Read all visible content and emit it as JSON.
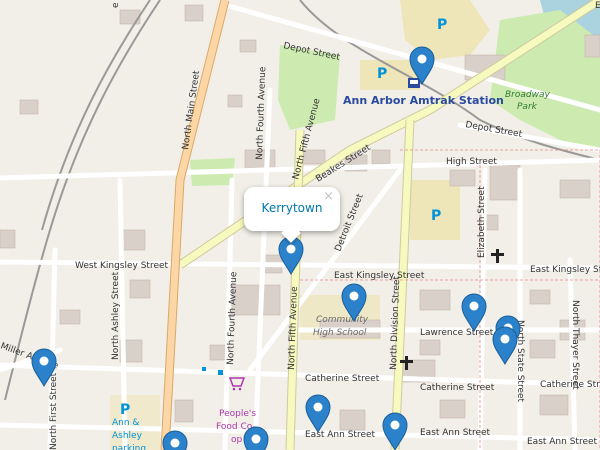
{
  "popup": {
    "title": "Kerrytown",
    "close_symbol": "×"
  },
  "labels": {
    "depot_street_1": "Depot Street",
    "depot_street_2": "Depot Street",
    "north_main": "North Main Street",
    "north_fourth": "North Fourth Avenue",
    "north_fourth_2": "North Fourth Avenue",
    "north_fifth_top": "North Fifth Avenue",
    "north_fifth": "North Fifth Avenue",
    "beakes": "Beakes Street",
    "high_street": "High Street",
    "detroit": "Detroit Street",
    "west_kingsley": "West Kingsley Street",
    "east_kingsley": "East Kingsley Street",
    "east_kingsley_2": "East Kingsley Street",
    "north_division": "North Division Street",
    "elizabeth": "Elizabeth Street",
    "north_state": "North State Street",
    "north_thayer": "North Thayer Street",
    "north_ashley": "North Ashley Street",
    "north_first": "North First Street",
    "miller": "Miller Avenue",
    "lawrence": "Lawrence Street",
    "catherine_1": "Catherine Street",
    "catherine_2": "Catherine Street",
    "catherine_3": "Catherine Street",
    "east_ann_1": "East Ann Street",
    "east_ann_2": "East Ann Street",
    "east_ann_3": "East Ann Street",
    "amtrak": "Ann Arbor Amtrak Station",
    "broadway_park_1": "Broadway",
    "broadway_park_2": "Park",
    "school_1": "Community",
    "school_2": "High School",
    "food_coop_1": "People's",
    "food_coop_2": "Food Co-",
    "food_coop_3": "op",
    "ann_ashley_1": "Ann &",
    "ann_ashley_2": "Ashley",
    "ann_ashley_3": "parking",
    "parking": "P",
    "edge_left": "e",
    "edge_right": "E"
  },
  "colors": {
    "land": "#f2efe9",
    "building": "#d9d0c9",
    "park": "#cdebb0",
    "parking_area": "#eee5b8",
    "major_road": "#fcd6a4",
    "secondary_road": "#f7fabf",
    "minor_road": "#ffffff",
    "marker": "#2b82cb",
    "water": "#aad3df",
    "label_blue": "#2a4aa0",
    "parking_blue": "#0092da"
  },
  "markers": [
    {
      "name": "amtrak-station-marker"
    },
    {
      "name": "kerrytown-marker"
    },
    {
      "name": "community-high-school-marker"
    },
    {
      "name": "north-state-marker-1"
    },
    {
      "name": "north-state-marker-2"
    },
    {
      "name": "north-state-marker-3"
    },
    {
      "name": "miller-avenue-marker"
    },
    {
      "name": "east-ann-marker-1"
    },
    {
      "name": "east-ann-marker-2"
    },
    {
      "name": "bottom-marker-1"
    },
    {
      "name": "bottom-marker-2"
    }
  ]
}
